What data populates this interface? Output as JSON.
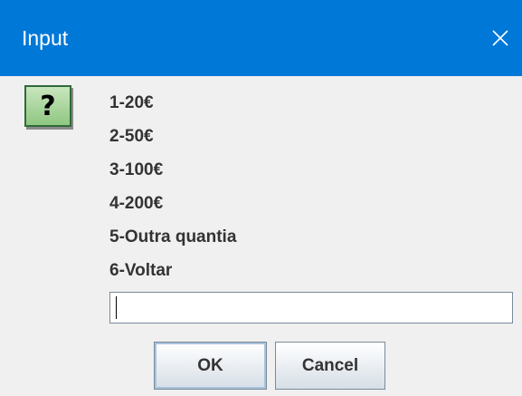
{
  "window": {
    "title": "Input",
    "close_icon": "close-icon"
  },
  "dialog": {
    "icon": "question-icon",
    "icon_glyph": "?",
    "options": [
      "1-20€",
      "2-50€",
      "3-100€",
      "4-200€",
      "5-Outra quantia",
      "6-Voltar"
    ],
    "input_value": ""
  },
  "buttons": {
    "ok_label": "OK",
    "cancel_label": "Cancel"
  },
  "colors": {
    "titlebar": "#0078d7",
    "dialog_background": "#f0f0f0",
    "icon_background": "#a8d59a"
  }
}
